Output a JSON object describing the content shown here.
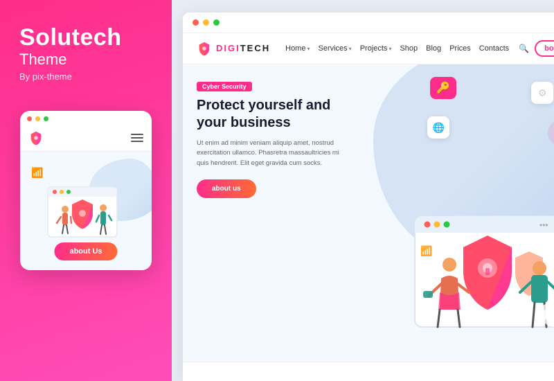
{
  "leftPanel": {
    "brandTitle": "Solutech",
    "brandSubtitle": "Theme",
    "brandBy": "By pix-theme",
    "mobileButton": "about Us"
  },
  "browser": {
    "nav": {
      "logoPrefix": "DIGI",
      "logoText": "TECH",
      "links": [
        {
          "label": "Home",
          "hasDropdown": true
        },
        {
          "label": "Services",
          "hasDropdown": true
        },
        {
          "label": "Projects",
          "hasDropdown": true
        },
        {
          "label": "Shop",
          "hasDropdown": false
        },
        {
          "label": "Blog",
          "hasDropdown": false
        },
        {
          "label": "Prices",
          "hasDropdown": false
        },
        {
          "label": "Contacts",
          "hasDropdown": false
        }
      ],
      "bookedLabel": "booked"
    },
    "hero": {
      "tag": "Cyber Security",
      "title": "Protect yourself and your business",
      "description": "Ut enim ad minim veniam aliquip amet, nostrud exercitation ullamco. Phasretra massaultricies mi quis hendrerit. Elit eget gravida cum socks.",
      "buttonLabel": "about us"
    }
  }
}
